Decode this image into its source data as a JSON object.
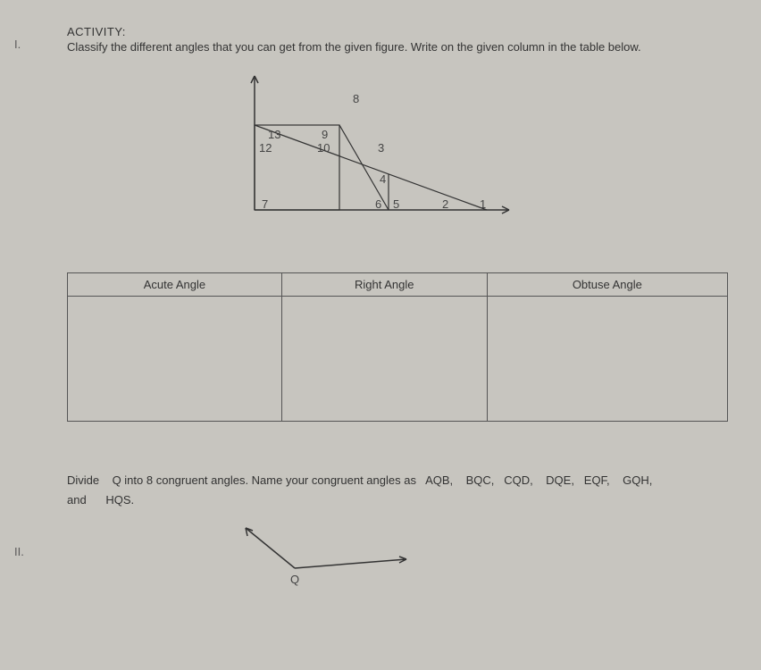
{
  "activity": {
    "label": "ACTIVITY:",
    "roman1": "I.",
    "instruction": "Classify the different angles that you can get from the given figure. Write on the given column in the table below."
  },
  "figure": {
    "labels": {
      "l1": "1",
      "l2": "2",
      "l3": "3",
      "l4": "4",
      "l5": "5",
      "l6": "6",
      "l7": "7",
      "l8": "8",
      "l9": "9",
      "l10": "10",
      "l12": "12",
      "l13": "13"
    }
  },
  "table": {
    "col1": "Acute Angle",
    "col2": "Right Angle",
    "col3": "Obtuse Angle"
  },
  "section2": {
    "roman2": "II.",
    "line1_prefix": "Divide    Q into 8 congruent angles. Name your congruent angles as   ",
    "angles": "AQB,    BQC,   CQD,    DQE,   EQF,    GQH,",
    "line2": "and      HQS.",
    "vertex_label": "Q"
  }
}
